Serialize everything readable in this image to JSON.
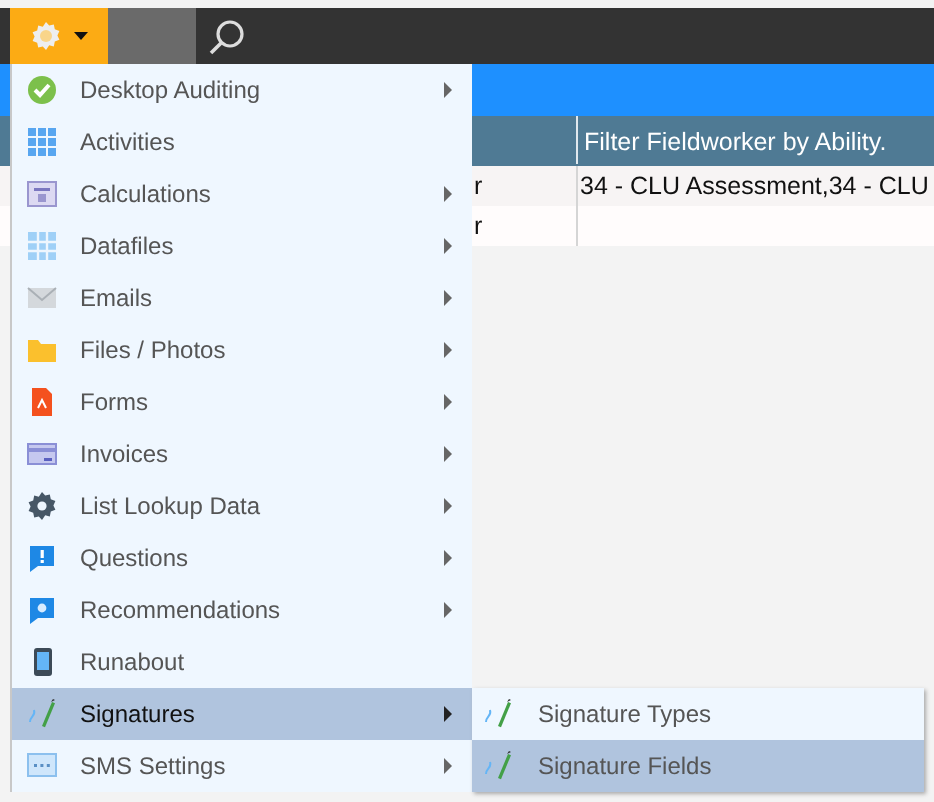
{
  "table": {
    "columns": [
      "Filter Fieldworker by Ability."
    ],
    "rows": [
      {
        "column_1": "r",
        "column_2": "34 - CLU Assessment,34 - CLU"
      },
      {
        "column_1": "r"
      }
    ]
  },
  "menu": {
    "items": [
      {
        "label": "Desktop Auditing",
        "has_submenu": true,
        "selected": false
      },
      {
        "label": "Activities",
        "has_submenu": false,
        "selected": false
      },
      {
        "label": "Calculations",
        "has_submenu": true,
        "selected": false
      },
      {
        "label": "Datafiles",
        "has_submenu": true,
        "selected": false
      },
      {
        "label": "Emails",
        "has_submenu": true,
        "selected": false
      },
      {
        "label": "Files / Photos",
        "has_submenu": true,
        "selected": false
      },
      {
        "label": "Forms",
        "has_submenu": true,
        "selected": false
      },
      {
        "label": "Invoices",
        "has_submenu": true,
        "selected": false
      },
      {
        "label": "List Lookup Data",
        "has_submenu": true,
        "selected": false
      },
      {
        "label": "Questions",
        "has_submenu": true,
        "selected": false
      },
      {
        "label": "Recommendations",
        "has_submenu": true,
        "selected": false
      },
      {
        "label": "Runabout",
        "has_submenu": false,
        "selected": false
      },
      {
        "label": "Signatures",
        "has_submenu": true,
        "selected": true,
        "children": [
          {
            "label": "Signature Types",
            "selected": false
          },
          {
            "label": "Signature Fields",
            "selected": true
          }
        ]
      },
      {
        "label": "SMS Settings",
        "has_submenu": true,
        "selected": false
      }
    ]
  }
}
